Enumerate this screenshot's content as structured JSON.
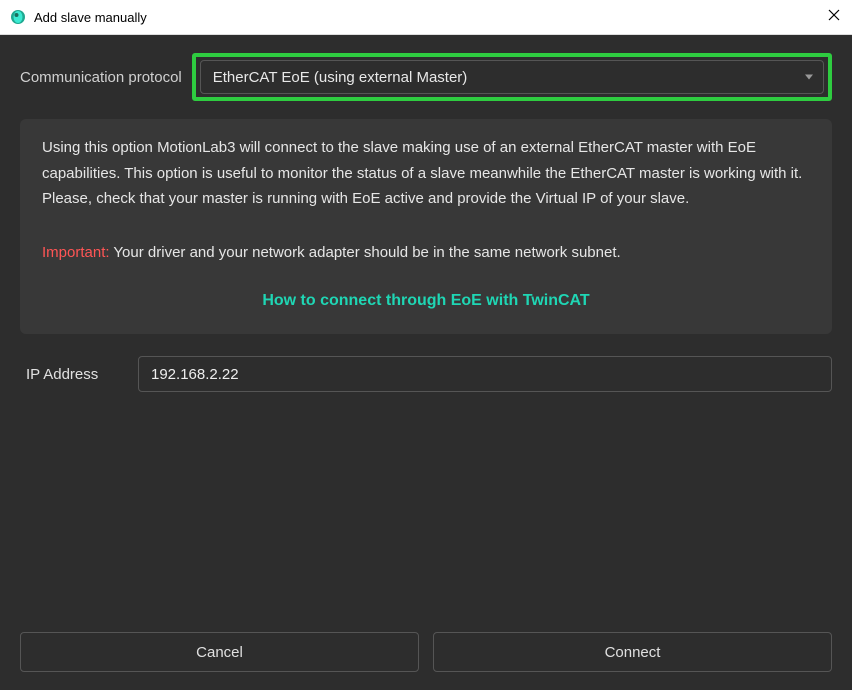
{
  "window": {
    "title": "Add slave manually"
  },
  "form": {
    "protocol_label": "Communication protocol",
    "protocol_value": "EtherCAT EoE (using external Master)",
    "info_text": "Using this option MotionLab3 will connect to the slave making use of an external EtherCAT master with EoE capabilities. This option is useful to monitor the status of a slave meanwhile the EtherCAT master is working with it. Please, check that your master is running with EoE active and provide the Virtual IP of your slave.",
    "important_label": "Important:",
    "important_text": " Your driver and your network adapter should be in the same network subnet.",
    "help_link": "How to connect through EoE with TwinCAT",
    "ip_label": "IP Address",
    "ip_value": "192.168.2.22"
  },
  "buttons": {
    "cancel": "Cancel",
    "connect": "Connect"
  }
}
